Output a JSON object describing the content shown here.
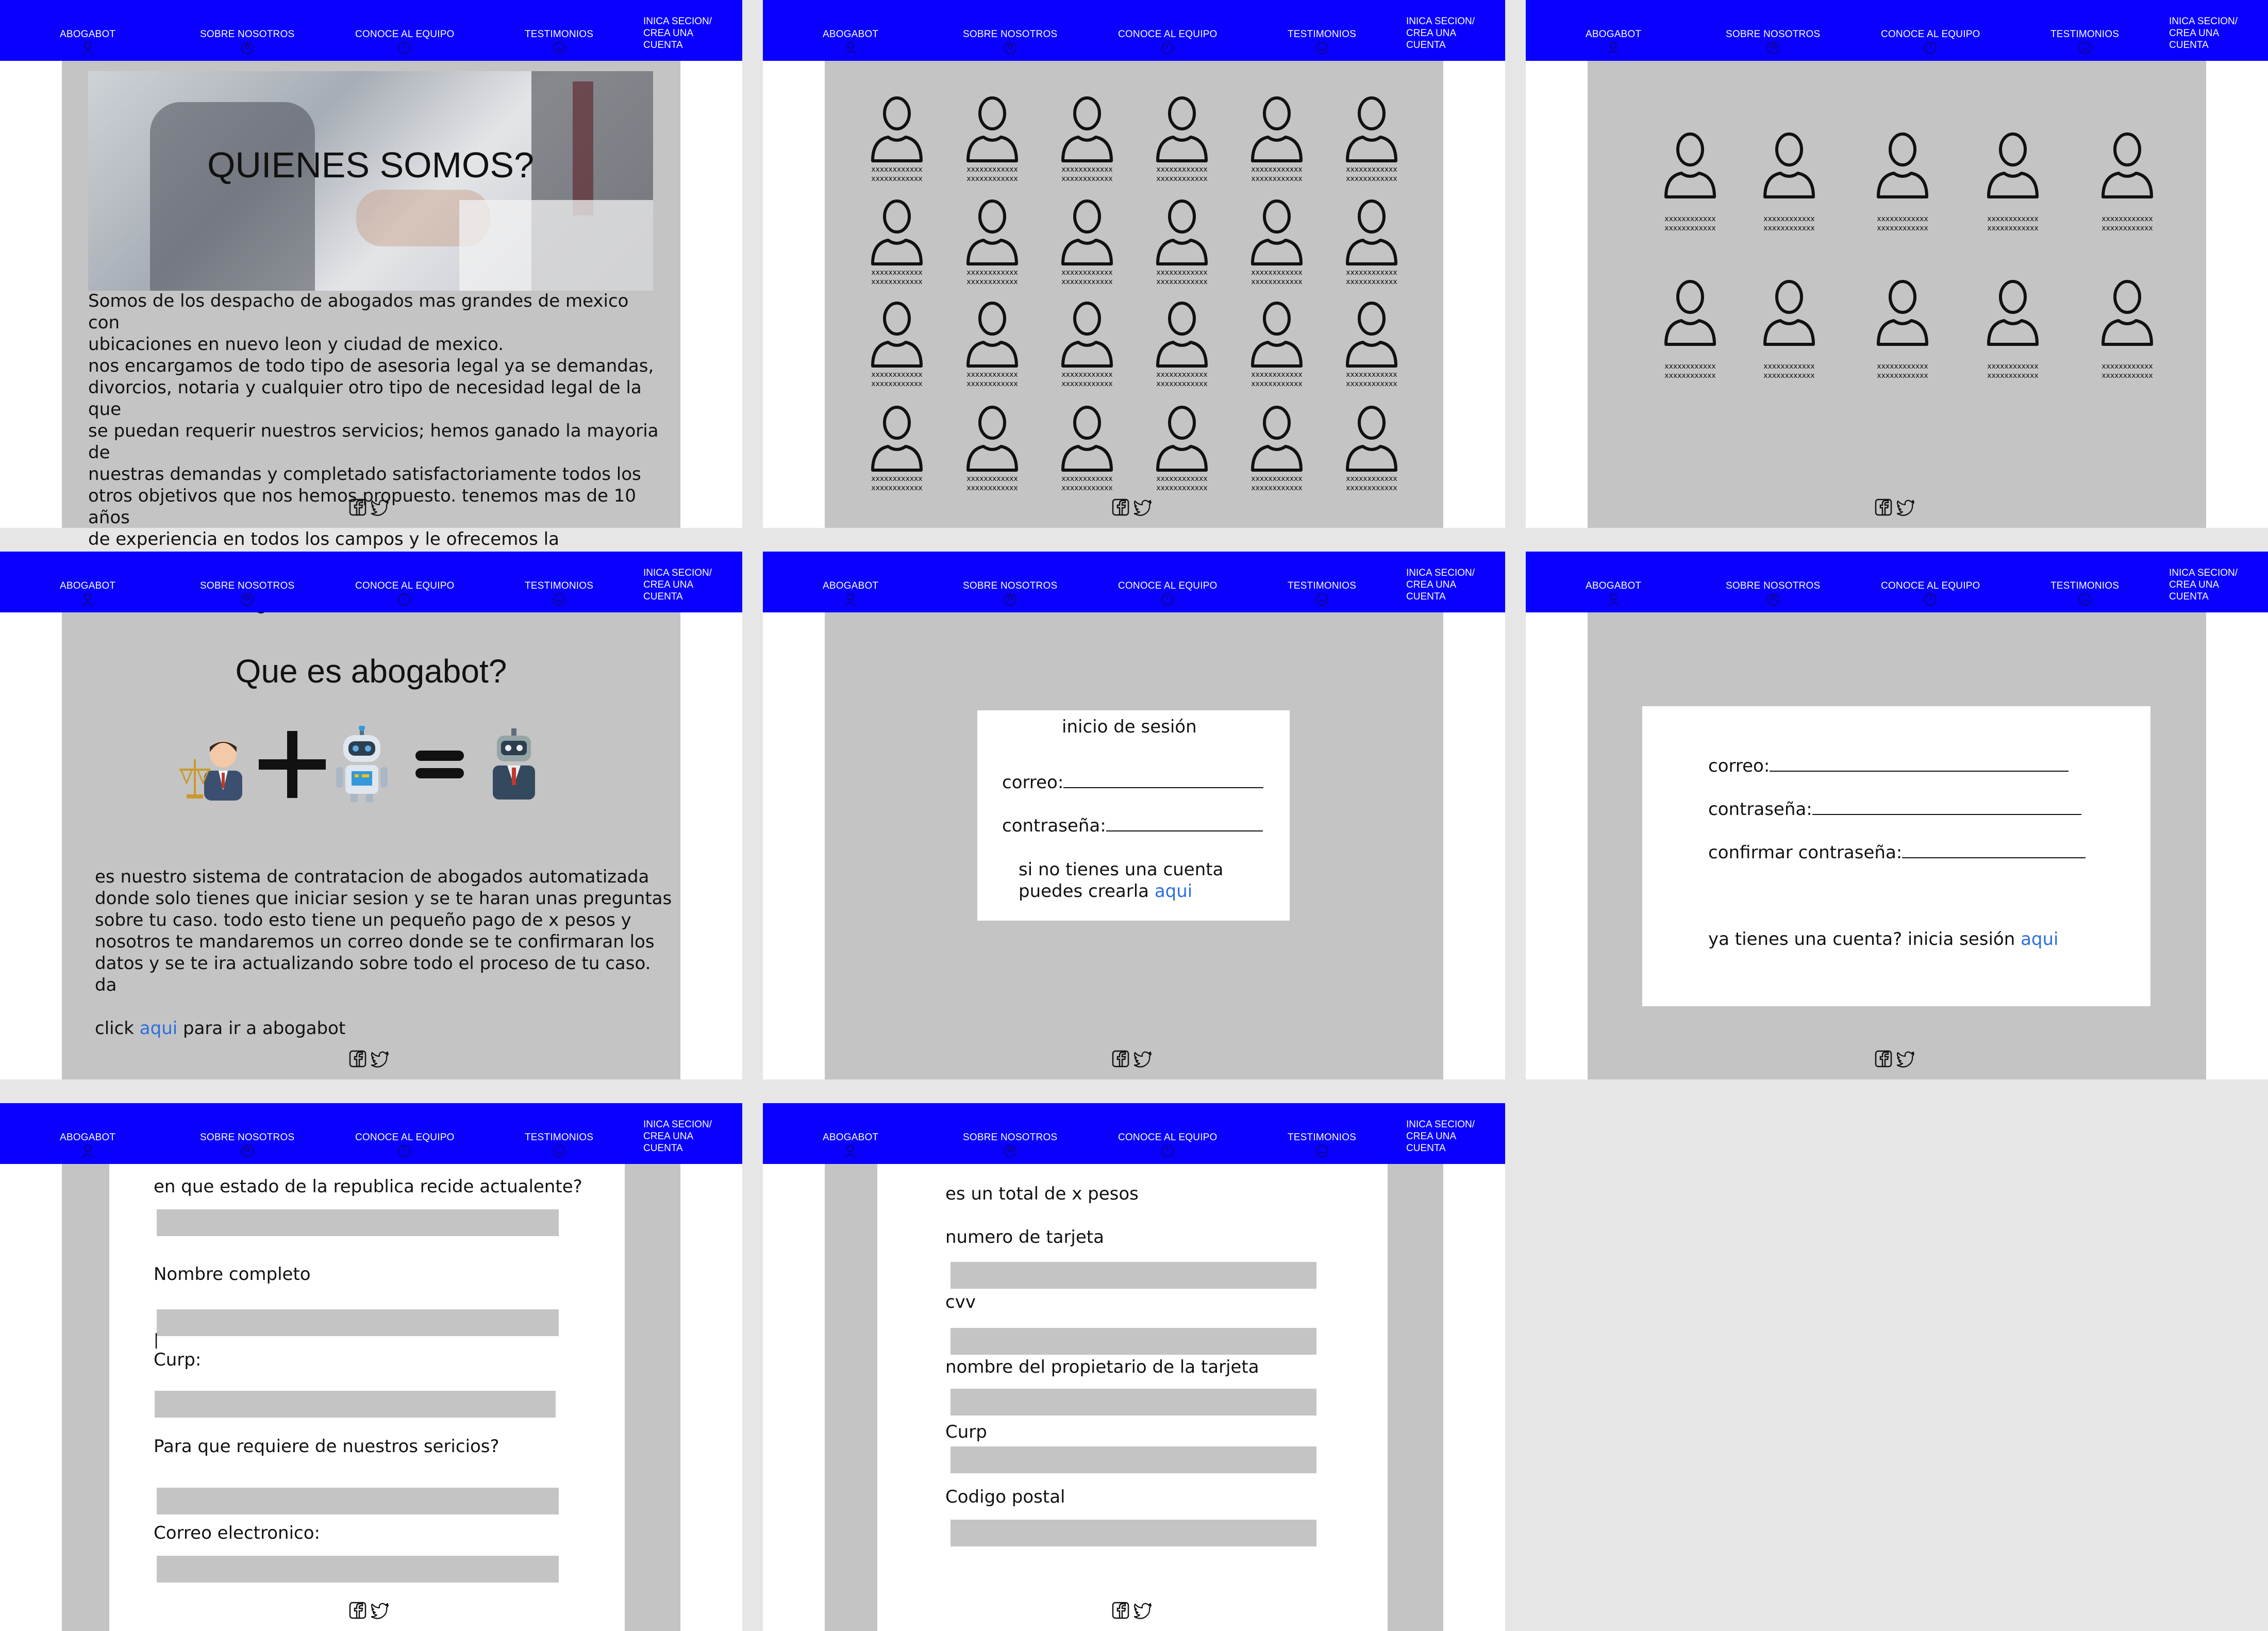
{
  "nav": {
    "brand": "ABOGABOT",
    "about": "SOBRE NOSOTROS",
    "team": "CONOCE AL EQUIPO",
    "testimonials": "TESTIMONIOS",
    "login": "INICA SECION/ CREA UNA CUENTA"
  },
  "about": {
    "title": "QUIENES SOMOS?",
    "text": "Somos de los despacho de abogados mas grandes de mexico  con\nubicaciones en nuevo leon y ciudad de mexico.\nnos encargamos de todo tipo de asesoria legal ya se demandas,\ndivorcios,  notaria y cualquier otro tipo de necesidad legal de la que\nse puedan requerir nuestros servicios; hemos ganado la mayoria de\nnuestras demandas y completado satisfactoriamente todos los\notros objetivos que nos hemos propuesto. tenemos mas de 10 años\nde experiencia en todos los campos y le ofrecemos la oportunidad\nde contratar nuestros servicios de manera mas comoda\nofreciendole el abogabot"
  },
  "team": {
    "member_name": "xxxxxxxxxxxx\nxxxxxxxxxxxx"
  },
  "what": {
    "title": "Que es abogabot?",
    "text": "es nuestro sistema de contratacion de abogados automatizada\ndonde solo tienes que iniciar sesion y se te haran unas preguntas\nsobre tu caso. todo esto tiene un pequeño pago de x pesos y\nnosotros te mandaremos un correo donde se te confirmaran los\ndatos y se te ira actualizando sobre todo el proceso de tu caso. da",
    "click_prefix": "click ",
    "link": "aqui",
    "click_suffix": " para ir a abogabot"
  },
  "login": {
    "title": "inicio de sesión",
    "email": "correo:",
    "password": "contraseña:",
    "no_account_1": "si no tienes una cuenta",
    "no_account_2": "puedes crearla ",
    "link": "aqui"
  },
  "register": {
    "email": "correo:",
    "password": "contraseña:",
    "confirm": "confirmar contraseña:",
    "have_account": "ya tienes una cuenta? inicia sesión ",
    "link": "aqui"
  },
  "questions": {
    "state": "en que estado de la republica recide actualente?",
    "name": "Nombre completo",
    "cursor": "|",
    "curp": "Curp:",
    "purpose": "Para que requiere de nuestros sericios?",
    "email": "Correo electronico:"
  },
  "payment": {
    "total": "es un total de x pesos",
    "card_number": "numero de tarjeta",
    "cvv": "cvv",
    "owner": "nombre del propietario de la tarjeta",
    "curp": "Curp",
    "postal": "Codigo postal"
  },
  "colors": {
    "nav_bg": "#0a00ff",
    "panel_bg": "#c4c4c4",
    "link": "#2b6fe0",
    "canvas": "#e6e6e6"
  }
}
